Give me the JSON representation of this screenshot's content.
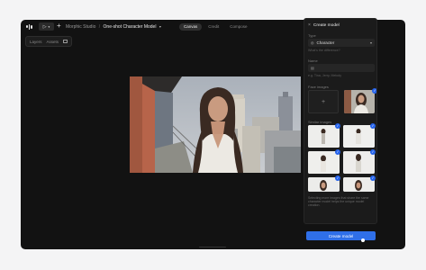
{
  "topbar": {
    "breadcrumb_root": "Morphic Studio",
    "breadcrumb_sep": "/",
    "breadcrumb_current": "One-shot Character Model",
    "modes": [
      {
        "label": "Canvas",
        "active": true
      },
      {
        "label": "Credit",
        "active": false
      },
      {
        "label": "Compose",
        "active": false
      }
    ]
  },
  "layers": {
    "tab_layers": "Layers",
    "tab_assets": "Assets"
  },
  "panel": {
    "title": "Create model",
    "type_label": "Type",
    "type_value": "Character",
    "type_hint": "What's the difference?",
    "name_label": "Name",
    "name_placeholder": "e.g. Tina, Jerry, Melody",
    "face_label": "Face images",
    "similar_label": "Similar images",
    "description": "Selecting more images that share the same character model helps the unique model creation.",
    "create_label": "Create model"
  },
  "colors": {
    "accent": "#2f6fe8",
    "badge": "#2563eb",
    "window_bg": "#121212",
    "panel_bg": "#1b1b1b"
  }
}
